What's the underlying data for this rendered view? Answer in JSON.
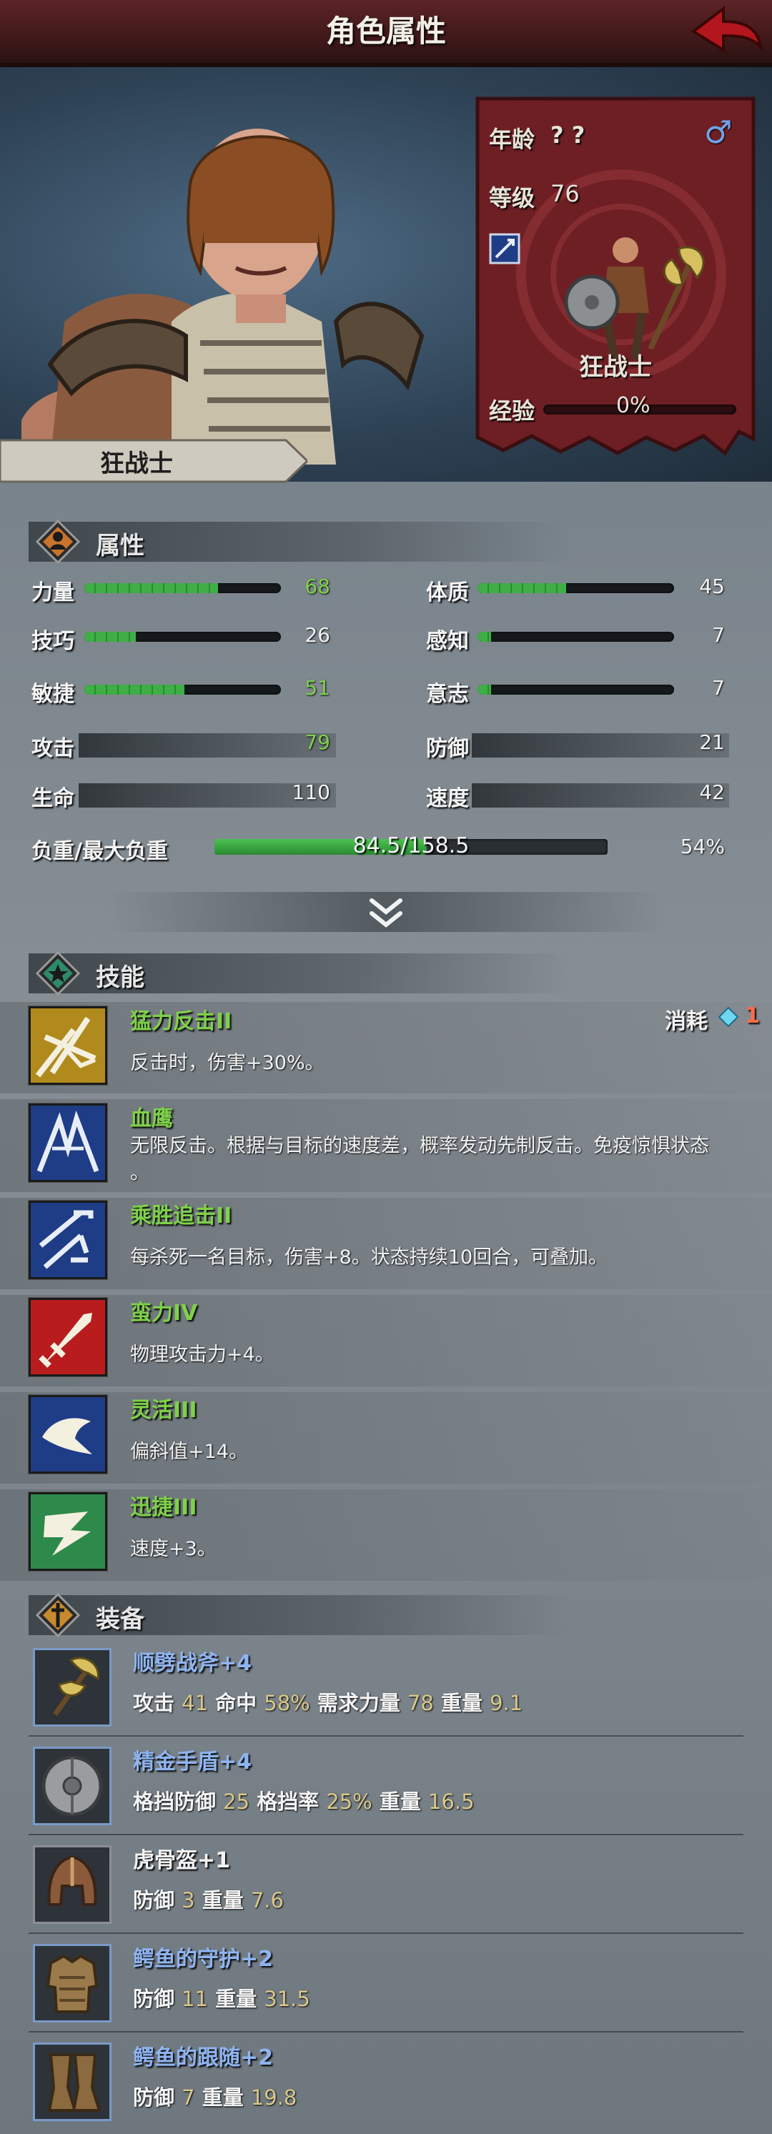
{
  "header": {
    "title": "角色属性"
  },
  "character": {
    "class_name": "狂战士",
    "panel_class_name": "狂战士",
    "age_label": "年龄",
    "age_value": "? ?",
    "level_label": "等级",
    "level_value": "76",
    "exp_label": "经验",
    "exp_value": "0%",
    "exp_fraction": 0.0,
    "gender_symbol": "♂"
  },
  "attributes": {
    "title": "属性",
    "stats": [
      {
        "label": "力量",
        "value": "68",
        "fill": 0.68
      },
      {
        "label": "体质",
        "value": "45",
        "fill": 0.45
      },
      {
        "label": "技巧",
        "value": "26",
        "fill": 0.26
      },
      {
        "label": "感知",
        "value": "7",
        "fill": 0.07
      },
      {
        "label": "敏捷",
        "value": "51",
        "fill": 0.51
      },
      {
        "label": "意志",
        "value": "7",
        "fill": 0.07
      }
    ],
    "plain": [
      {
        "label": "攻击",
        "value": "79"
      },
      {
        "label": "防御",
        "value": "21"
      },
      {
        "label": "生命",
        "value": "110"
      },
      {
        "label": "速度",
        "value": "42"
      }
    ],
    "load_label": "负重/最大负重",
    "load_value": "84.5/158.5",
    "load_percent": "54%",
    "load_fraction": 0.54
  },
  "skills": {
    "title": "技能",
    "cost_label": "消耗",
    "cost_value": "1",
    "items": [
      {
        "name": "猛力反击II",
        "desc": "反击时，伤害+30%。"
      },
      {
        "name": "血鹰",
        "desc": "无限反击。根据与目标的速度差，概率发动先制反击。免疫惊惧状态",
        "desc2": "。"
      },
      {
        "name": "乘胜追击II",
        "desc": "每杀死一名目标，伤害+8。状态持续10回合，可叠加。"
      },
      {
        "name": "蛮力IV",
        "desc": "物理攻击力+4。"
      },
      {
        "name": "灵活III",
        "desc": "偏斜值+14。"
      },
      {
        "name": "迅捷III",
        "desc": "速度+3。"
      }
    ]
  },
  "equipment": {
    "title": "装备",
    "items": [
      {
        "name": "顺劈战斧",
        "plus": "+4",
        "stats": [
          [
            "攻击",
            "41"
          ],
          [
            "命中",
            "58%"
          ],
          [
            "需求力量",
            "78"
          ],
          [
            "重量",
            "9.1"
          ]
        ]
      },
      {
        "name": "精金手盾",
        "plus": "+4",
        "stats": [
          [
            "格挡防御",
            "25"
          ],
          [
            "格挡率",
            "25%"
          ],
          [
            "重量",
            "16.5"
          ]
        ]
      },
      {
        "name": "虎骨盔",
        "plus": "+1",
        "stats": [
          [
            "防御",
            "3"
          ],
          [
            "重量",
            "7.6"
          ]
        ]
      },
      {
        "name": "鳄鱼的守护",
        "plus": "+2",
        "stats": [
          [
            "防御",
            "11"
          ],
          [
            "重量",
            "31.5"
          ]
        ]
      },
      {
        "name": "鳄鱼的跟随",
        "plus": "+2",
        "stats": [
          [
            "防御",
            "7"
          ],
          [
            "重量",
            "19.8"
          ]
        ]
      }
    ]
  },
  "colors": {
    "skill_name": "#7fd04a",
    "equip_name_blue": "#8fb4f0",
    "equip_name_white": "#f2f2f2",
    "value_gold": "#d9c88a",
    "bar_green": "#3fae46",
    "cost_red": "#ff6a4a",
    "panel_red": "#6e1f24"
  }
}
